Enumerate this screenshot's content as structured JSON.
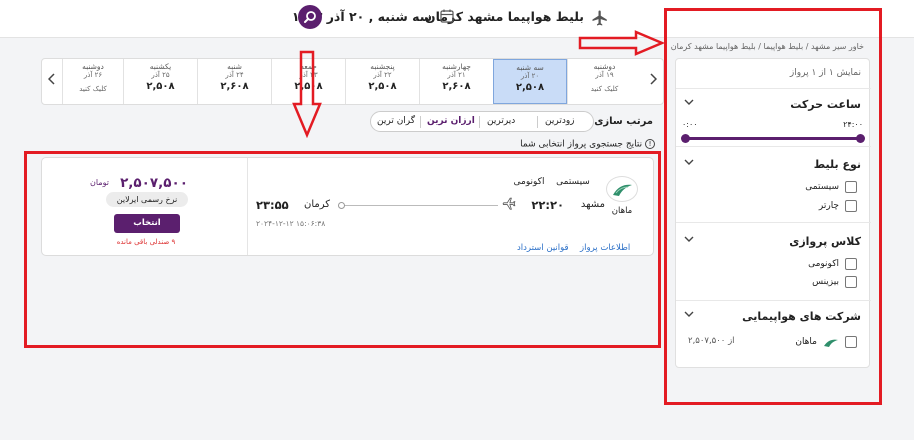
{
  "header": {
    "title": "بلیط هواپیما مشهد کرمان",
    "date": "سه شنبه , ۲۰ آذر ۱۴۰۳",
    "plane_icon": "airplane-icon",
    "calendar_icon": "calendar-icon",
    "search_icon": "search-icon"
  },
  "breadcrumb": "خاور سیر مشهد / بلیط هواپیما / بلیط هواپیما مشهد کرمان",
  "sidebar": {
    "result_count": "نمایش ۱ از ۱ پرواز",
    "departure": {
      "title": "ساعت حرکت",
      "from": "۰:۰۰",
      "to": "۲۴:۰۰"
    },
    "ticket_type": {
      "title": "نوع بلیط",
      "options": [
        "سیستمی",
        "چارتر"
      ]
    },
    "flight_class": {
      "title": "کلاس پروازی",
      "options": [
        "اکونومی",
        "بیزینس"
      ]
    },
    "airlines": {
      "title": "شرکت های هواپیمایی",
      "items": [
        {
          "name": "ماهان",
          "price": "از ۲,۵۰۷,۵۰۰"
        }
      ]
    }
  },
  "date_strip": {
    "days": [
      {
        "name": "دوشنبه",
        "date": "۱۹ آذر",
        "price": "",
        "cta": "کلیک کنید"
      },
      {
        "name": "سه شنبه",
        "date": "۲۰ آذر",
        "price": "۲,۵۰۸",
        "cta": ""
      },
      {
        "name": "چهارشنبه",
        "date": "۲۱ آذر",
        "price": "۲,۶۰۸",
        "cta": ""
      },
      {
        "name": "پنجشنبه",
        "date": "۲۲ آذر",
        "price": "۲,۵۰۸",
        "cta": ""
      },
      {
        "name": "جمعه",
        "date": "۲۳ آذر",
        "price": "۲,۵۰۸",
        "cta": ""
      },
      {
        "name": "شنبه",
        "date": "۲۴ آذر",
        "price": "۲,۶۰۸",
        "cta": ""
      },
      {
        "name": "یکشنبه",
        "date": "۲۵ آذر",
        "price": "۲,۵۰۸",
        "cta": ""
      },
      {
        "name": "دوشنبه",
        "date": "۲۶ آذر",
        "price": "",
        "cta": "کلیک کنید"
      }
    ]
  },
  "sort": {
    "label": "مرتب سازی :",
    "options": [
      "زودترین",
      "دیرترین",
      "ارزان ترین",
      "گران ترین"
    ]
  },
  "result_info": "نتایج جستجوی پرواز انتخابی شما",
  "flight": {
    "airline": "ماهان",
    "ticket_type": "سیستمی",
    "flight_class": "اکونومی",
    "departure_city": "مشهد",
    "departure_time": "۲۲:۲۰",
    "arrival_city": "کرمان",
    "arrival_time": "۲۳:۵۵",
    "code": "۲۰۲۴-۱۲-۱۲ ۱۵:۰۶:۳۸",
    "link_info": "اطلاعات پرواز",
    "link_rules": "قوانین استرداد",
    "price": "۲,۵۰۷,۵۰۰",
    "currency": "تومان",
    "fare_type": "نرخ رسمی ایرلاین",
    "select_label": "انتخاب",
    "seats_left": "۹ صندلی باقی مانده"
  },
  "colors": {
    "brand": "#5b1f6e",
    "annotation": "#e31b23",
    "active_date": "#c9dcf7"
  }
}
